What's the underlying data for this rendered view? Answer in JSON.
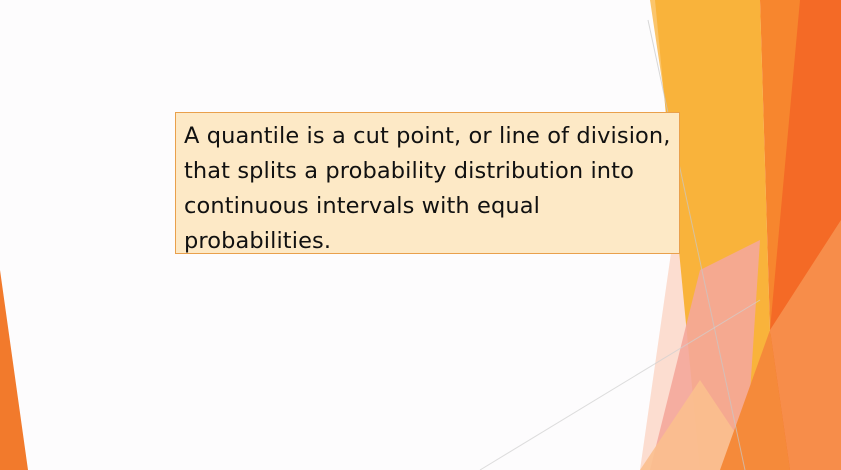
{
  "slide": {
    "background_color": "#fdfcfd",
    "callout": {
      "text": "A quantile is a cut point, or line of division, that splits a probability distribution into continuous intervals with equal probabilities.",
      "fill_color": "#fde9c6",
      "border_color": "#e9a04c"
    },
    "decoration": {
      "style": "faceted-orange-triangles",
      "colors": [
        "#f9b33b",
        "#f7862e",
        "#f46a26",
        "#f4a79a",
        "#fbd7c8"
      ]
    }
  }
}
